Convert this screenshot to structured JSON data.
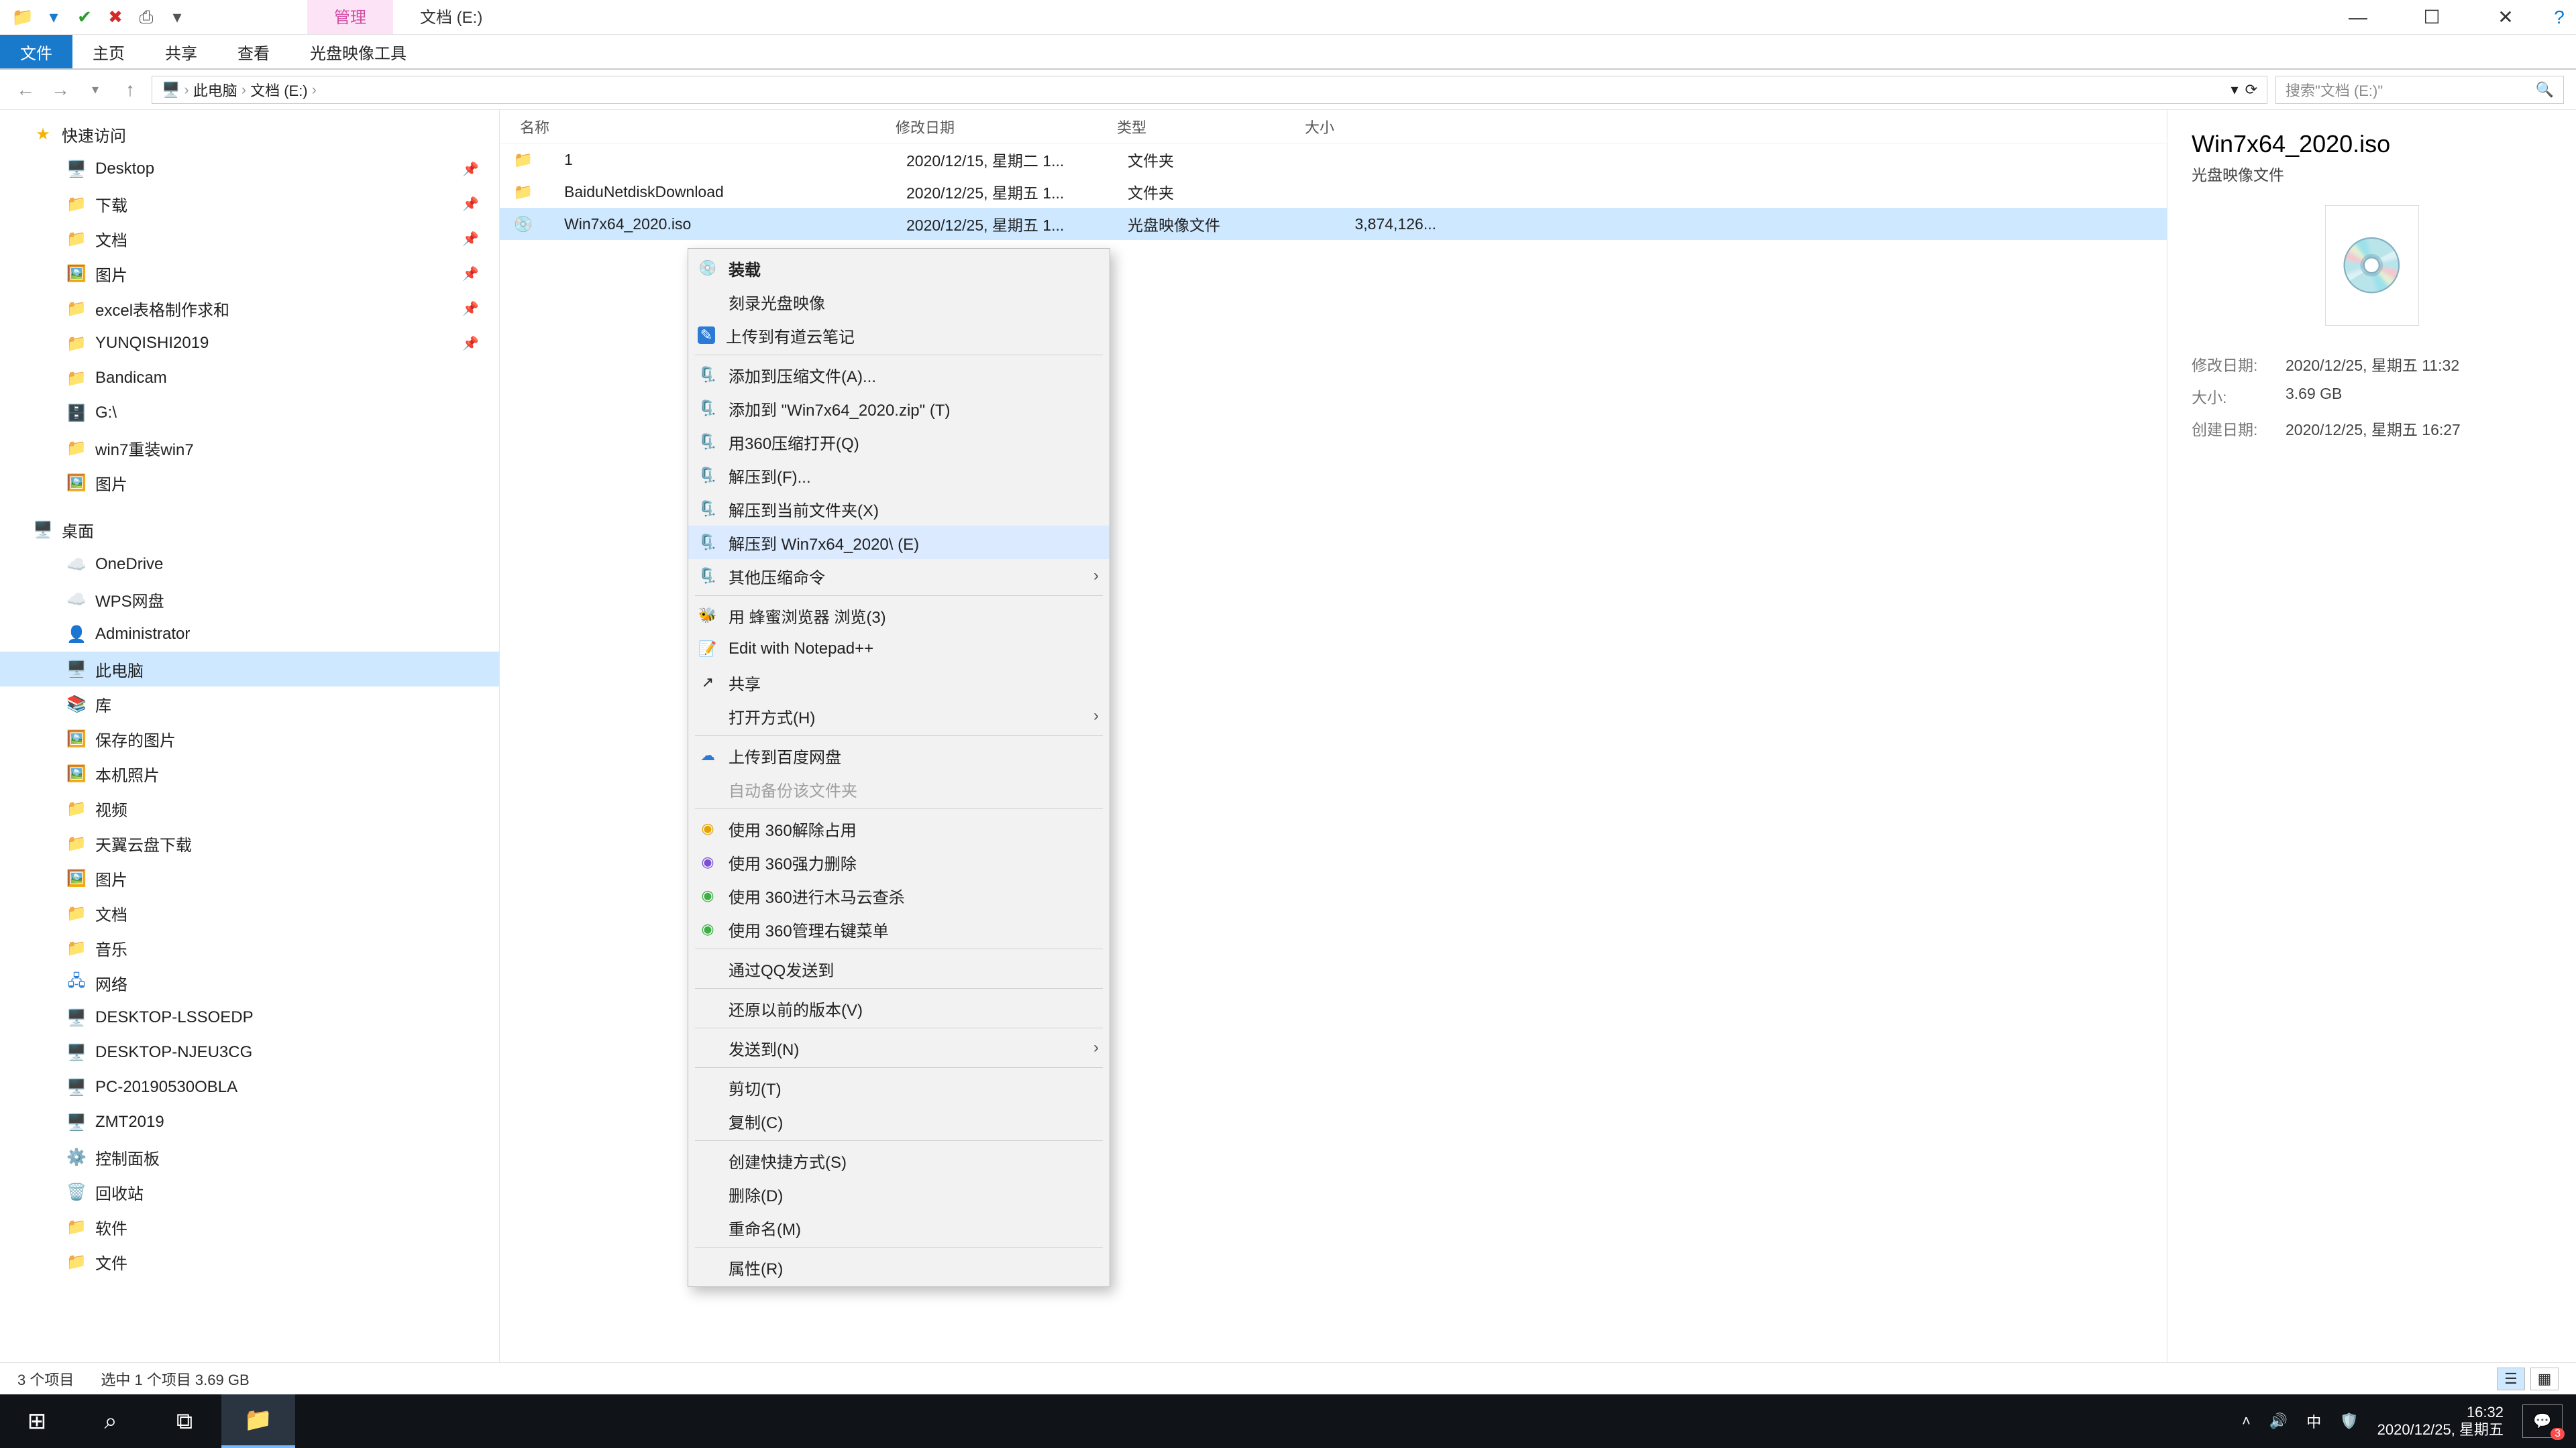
{
  "titlebar": {
    "manage_tab": "管理",
    "location_tab": "文档 (E:)"
  },
  "ribbon": {
    "file": "文件",
    "home": "主页",
    "share": "共享",
    "view": "查看",
    "disc_tools": "光盘映像工具"
  },
  "breadcrumb": {
    "root": "此电脑",
    "drive": "文档 (E:)"
  },
  "search_placeholder": "搜索\"文档 (E:)\"",
  "nav": {
    "quick_access": "快速访问",
    "desktop": "Desktop",
    "downloads": "下载",
    "documents": "文档",
    "pictures_en": "图片",
    "excel": "excel表格制作求和",
    "yunqishi": "YUNQISHI2019",
    "bandicam": "Bandicam",
    "gdrive": "G:\\",
    "win7reinstall": "win7重装win7",
    "pictures": "图片",
    "desk_cn": "桌面",
    "onedrive": "OneDrive",
    "wps": "WPS网盘",
    "admin": "Administrator",
    "thispc": "此电脑",
    "libs": "库",
    "saved_pics": "保存的图片",
    "local_photos": "本机照片",
    "videos": "视频",
    "tianyi": "天翼云盘下载",
    "pics2": "图片",
    "docs2": "文档",
    "music": "音乐",
    "network": "网络",
    "pc1": "DESKTOP-LSSOEDP",
    "pc2": "DESKTOP-NJEU3CG",
    "pc3": "PC-20190530OBLA",
    "pc4": "ZMT2019",
    "ctrlpanel": "控制面板",
    "recycle": "回收站",
    "soft": "软件",
    "files": "文件"
  },
  "columns": {
    "name": "名称",
    "date": "修改日期",
    "type": "类型",
    "size": "大小"
  },
  "rows": [
    {
      "name": "1",
      "date": "2020/12/15, 星期二 1...",
      "type": "文件夹",
      "size": ""
    },
    {
      "name": "BaiduNetdiskDownload",
      "date": "2020/12/25, 星期五 1...",
      "type": "文件夹",
      "size": ""
    },
    {
      "name": "Win7x64_2020.iso",
      "date": "2020/12/25, 星期五 1...",
      "type": "光盘映像文件",
      "size": "3,874,126..."
    }
  ],
  "ctx": {
    "mount": "装载",
    "burn": "刻录光盘映像",
    "youdao": "上传到有道云笔记",
    "add_archive": "添加到压缩文件(A)...",
    "add_zip": "添加到 \"Win7x64_2020.zip\" (T)",
    "open_360zip": "用360压缩打开(Q)",
    "extract_to": "解压到(F)...",
    "extract_here": "解压到当前文件夹(X)",
    "extract_named": "解压到 Win7x64_2020\\ (E)",
    "other_compress": "其他压缩命令",
    "browse_bee": "用 蜂蜜浏览器 浏览(3)",
    "notepadpp": "Edit with Notepad++",
    "share": "共享",
    "open_with": "打开方式(H)",
    "upload_baidu": "上传到百度网盘",
    "auto_backup": "自动备份该文件夹",
    "u360_unlock": "使用 360解除占用",
    "u360_force_del": "使用 360强力删除",
    "u360_trojan": "使用 360进行木马云查杀",
    "u360_menu": "使用 360管理右键菜单",
    "qq_send": "通过QQ发送到",
    "restore_prev": "还原以前的版本(V)",
    "send_to": "发送到(N)",
    "cut": "剪切(T)",
    "copy": "复制(C)",
    "shortcut": "创建快捷方式(S)",
    "delete": "删除(D)",
    "rename": "重命名(M)",
    "properties": "属性(R)"
  },
  "details": {
    "filename": "Win7x64_2020.iso",
    "filetype": "光盘映像文件",
    "mod_label": "修改日期:",
    "mod_value": "2020/12/25, 星期五 11:32",
    "size_label": "大小:",
    "size_value": "3.69 GB",
    "create_label": "创建日期:",
    "create_value": "2020/12/25, 星期五 16:27"
  },
  "status": {
    "count": "3 个项目",
    "selection": "选中 1 个项目  3.69 GB"
  },
  "tray": {
    "ime": "中",
    "time": "16:32",
    "date": "2020/12/25, 星期五",
    "notif_count": "3"
  }
}
